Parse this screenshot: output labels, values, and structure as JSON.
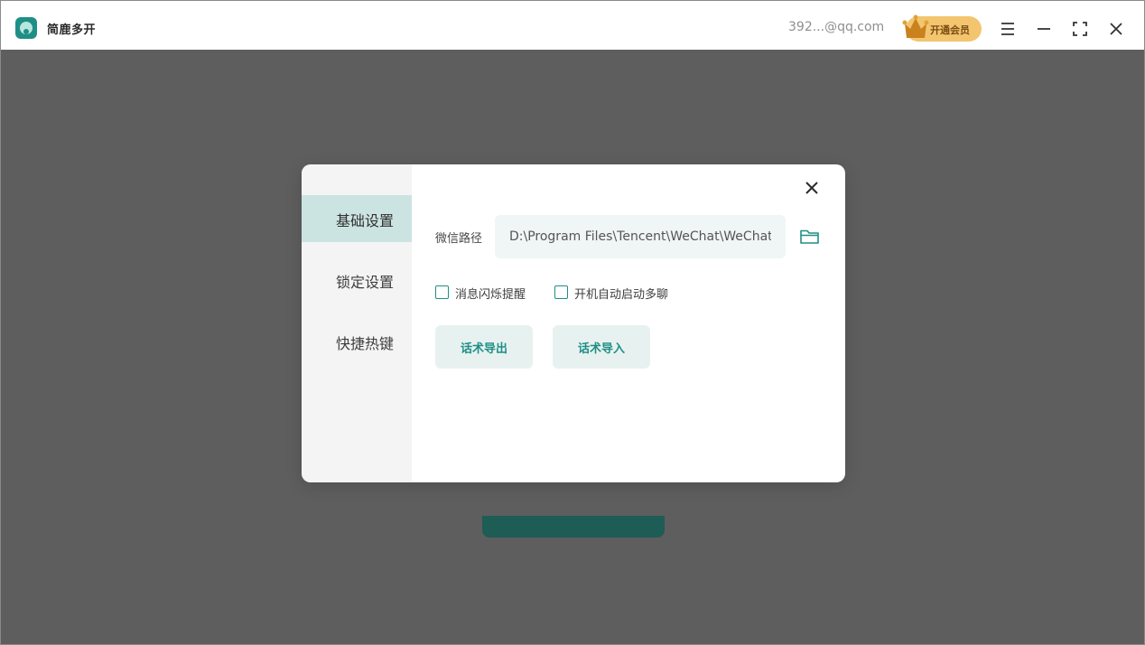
{
  "app": {
    "title": "简鹿多开",
    "account": "392...@qq.com",
    "vip_label": "开通会员",
    "brand_color": "#1f8f86"
  },
  "window_controls": {
    "menu_icon": "menu-icon",
    "minimize_icon": "minimize-icon",
    "maximize_icon": "maximize-icon",
    "close_icon": "close-icon"
  },
  "dialog": {
    "sidebar": {
      "items": [
        {
          "label": "基础设置",
          "active": true
        },
        {
          "label": "锁定设置",
          "active": false
        },
        {
          "label": "快捷热键",
          "active": false
        }
      ]
    },
    "wechat_path": {
      "label": "微信路径",
      "value": "D:\\Program Files\\Tencent\\WeChat\\WeChat.exe"
    },
    "options": [
      {
        "label": "消息闪烁提醒",
        "checked": false
      },
      {
        "label": "开机自动启动多聊",
        "checked": false
      }
    ],
    "buttons": {
      "export": "话术导出",
      "import": "话术导入"
    }
  }
}
